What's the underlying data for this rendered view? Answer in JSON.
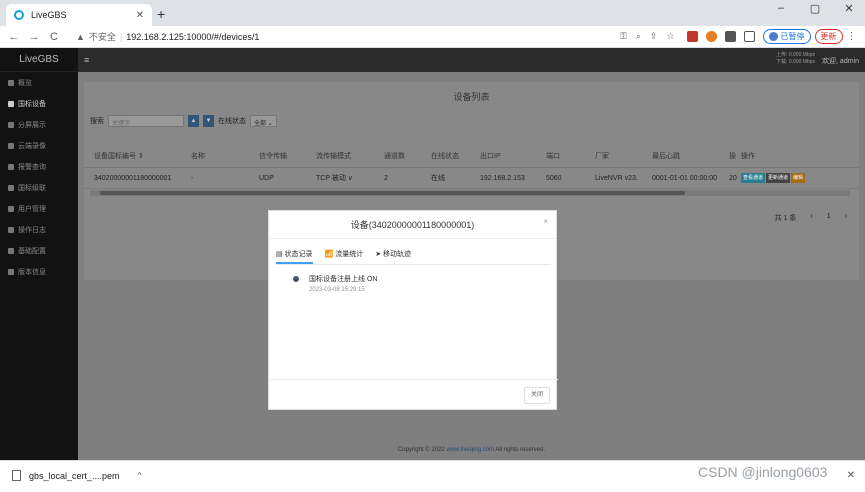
{
  "browser": {
    "tab_title": "LiveGBS",
    "tab_close": "✕",
    "new_tab": "+",
    "window_controls": [
      "–",
      "▢",
      "✕"
    ],
    "nav": [
      "←",
      "→",
      "C"
    ],
    "security_label": "不安全",
    "url": "192.168.2.125:10000/#/devices/1",
    "profile_label": "已暂停",
    "update_label": "更新",
    "menu": "⋮"
  },
  "app": {
    "brand": "LiveGBS",
    "sidebar": [
      "概览",
      "国标设备",
      "分屏展示",
      "云端录像",
      "报警查询",
      "国标级联",
      "用户管理",
      "操作日志",
      "基础配置",
      "版本信息"
    ],
    "topbar": {
      "menu": "≡",
      "net_up": "上传: 0.000 Mbps",
      "net_down": "下载: 0.000 Mbps",
      "user": "欢迎, admin"
    },
    "page_title": "设备列表",
    "search_label": "搜索",
    "search_placeholder": "关键字",
    "online_label": "在线状态",
    "online_value": "全部",
    "columns": [
      "设备国标编号 ⇕",
      "名称",
      "信令传输",
      "流传输模式",
      "通道数",
      "在线状态",
      "出口IP",
      "端口",
      "厂家",
      "最后心跳",
      "操",
      "操作"
    ],
    "row": [
      "34020000001180000001",
      "-",
      "UDP",
      "TCP 被动 ∨",
      "2",
      "在线",
      "192.168.2.153",
      "5060",
      "LiveNVR v23.",
      "0001-01-01 00:00:00",
      "20"
    ],
    "op_buttons": [
      "查看通道",
      "更新通道",
      "编辑"
    ],
    "pager": [
      "共 1 条",
      "‹",
      "1",
      "›"
    ],
    "footer_prefix": "Copyright © 2022 ",
    "footer_link": "www.liveqing.com",
    "footer_suffix": " All rights reserved."
  },
  "modal": {
    "title": "设备(34020000001180000001)",
    "close": "×",
    "tabs": [
      "▤ 状态记录",
      "📶 流量统计",
      "➤ 移动轨迹"
    ],
    "event_title": "国标设备注册上线 ON",
    "event_time": "2023-03-08 15:29:15",
    "button": "关闭"
  },
  "download": {
    "filename": "gbs_local_cert_....pem",
    "caret": "^",
    "close": "✕"
  },
  "watermark": "CSDN @jinlong0603"
}
